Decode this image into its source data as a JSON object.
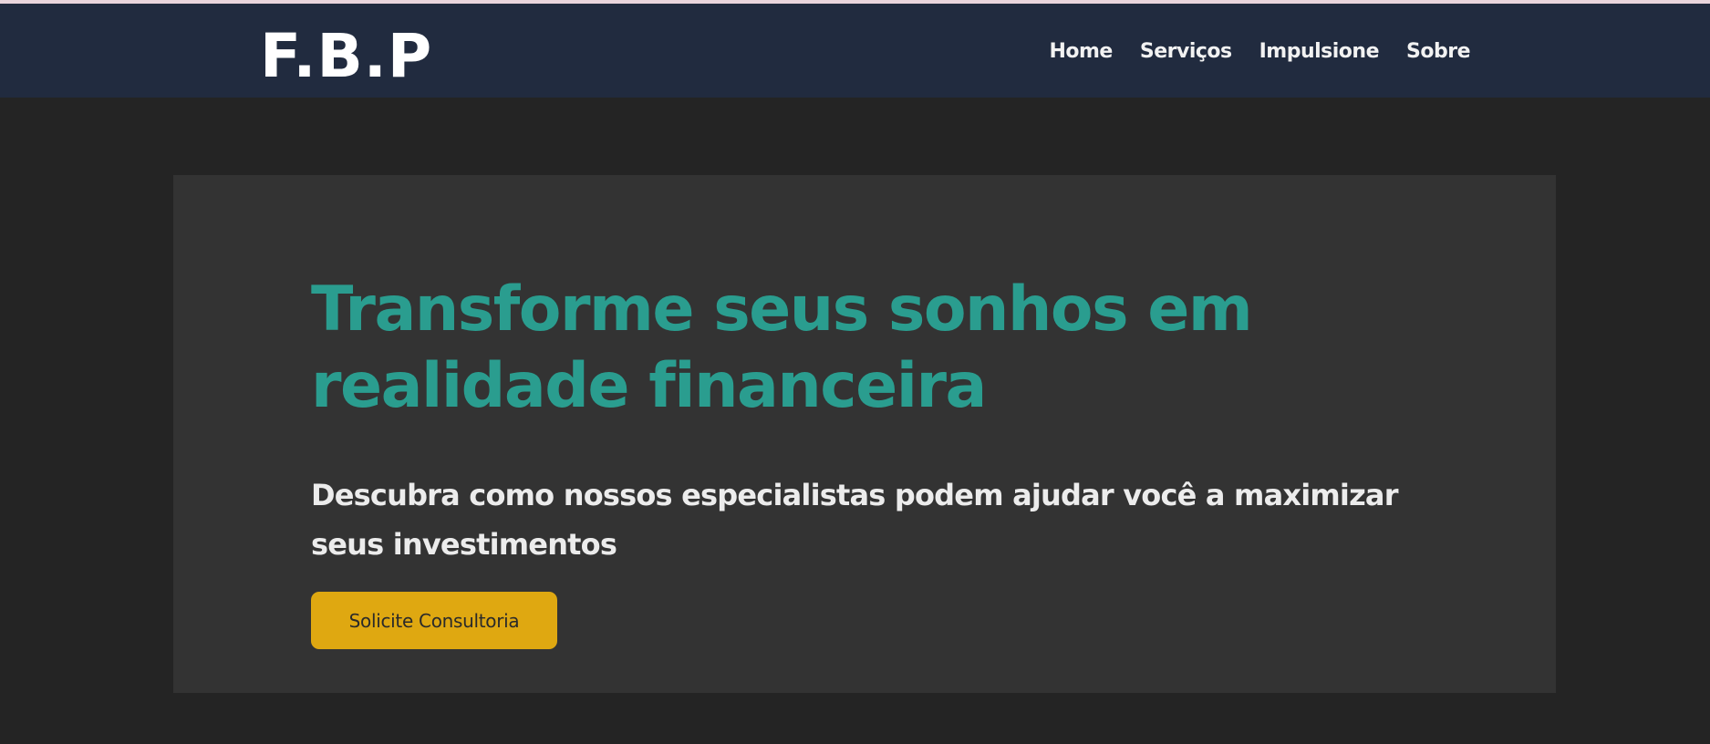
{
  "header": {
    "logo": "F.B.P",
    "nav_items": [
      "Home",
      "Serviços",
      "Impulsione",
      "Sobre"
    ]
  },
  "hero": {
    "title": "Transforme seus sonhos em realidade financeira",
    "subtitle": "Descubra como nossos especialistas podem ajudar você a maximizar seus investimentos",
    "cta_label": "Solicite Consultoria"
  },
  "colors": {
    "navbar_bg": "#212b3f",
    "page_bg": "#242424",
    "hero_bg": "#333333",
    "title_accent": "#2a9d8f",
    "cta_bg": "#dfa811"
  }
}
